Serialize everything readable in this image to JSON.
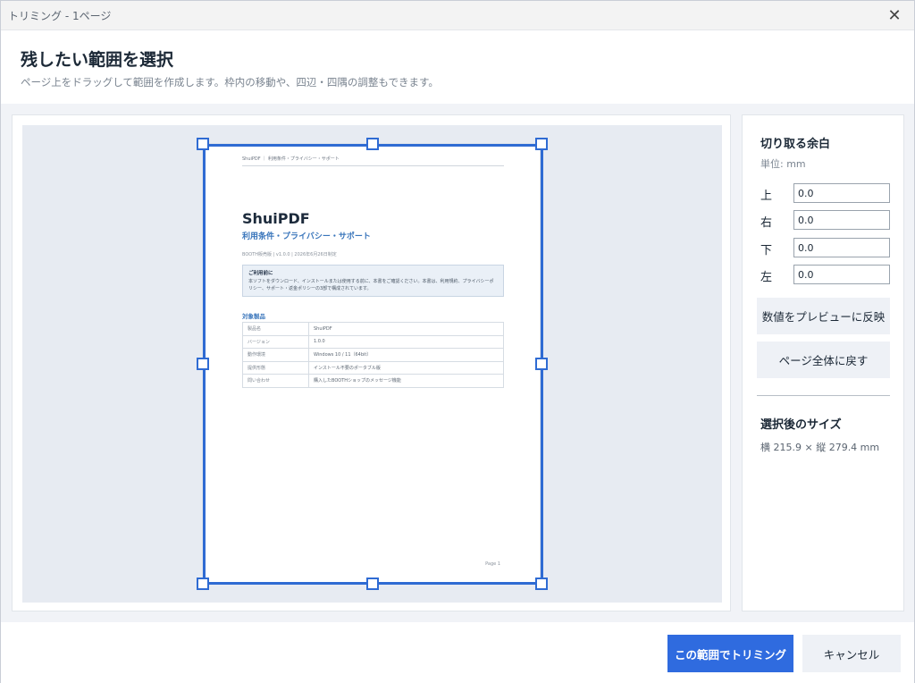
{
  "window": {
    "title": "トリミング - 1ページ"
  },
  "header": {
    "title": "残したい範囲を選択",
    "subtitle": "ページ上をドラッグして範囲を作成します。枠内の移動や、四辺・四隅の調整もできます。"
  },
  "page": {
    "running_head": "ShuiPDF ｜ 利用条件・プライバシー・サポート",
    "title": "ShuiPDF",
    "subtitle": "利用条件・プライバシー・サポート",
    "meta": "BOOTH販売版 | v1.0.0 | 2026年6月26日制定",
    "notice_title": "ご利用前に",
    "notice_body": "本ソフトをダウンロード、インストールまたは使用する前に、本書をご確認ください。本書は、利用規約、プライバシーポリシー、サポート・返金ポリシーの3部で構成されています。",
    "section_title": "対象製品",
    "table": [
      {
        "key": "製品名",
        "value": "ShuiPDF"
      },
      {
        "key": "バージョン",
        "value": "1.0.0"
      },
      {
        "key": "動作環境",
        "value": "Windows 10 / 11（64bit）"
      },
      {
        "key": "提供形態",
        "value": "インストール不要のポータブル版"
      },
      {
        "key": "問い合わせ",
        "value": "購入したBOOTHショップのメッセージ機能"
      }
    ],
    "page_number": "Page 1"
  },
  "margins": {
    "title": "切り取る余白",
    "unit": "単位: mm",
    "fields": [
      {
        "label": "上",
        "value": "0.0"
      },
      {
        "label": "右",
        "value": "0.0"
      },
      {
        "label": "下",
        "value": "0.0"
      },
      {
        "label": "左",
        "value": "0.0"
      }
    ],
    "apply_button": "数値をプレビューに反映",
    "reset_button": "ページ全体に戻す"
  },
  "selection": {
    "title": "選択後のサイズ",
    "size": "横 215.9 × 縦 279.4 mm"
  },
  "footer": {
    "confirm_button": "この範囲でトリミング",
    "cancel_button": "キャンセル"
  },
  "colors": {
    "accent": "#2f6bdf",
    "crop_frame": "#2f6bd3"
  }
}
